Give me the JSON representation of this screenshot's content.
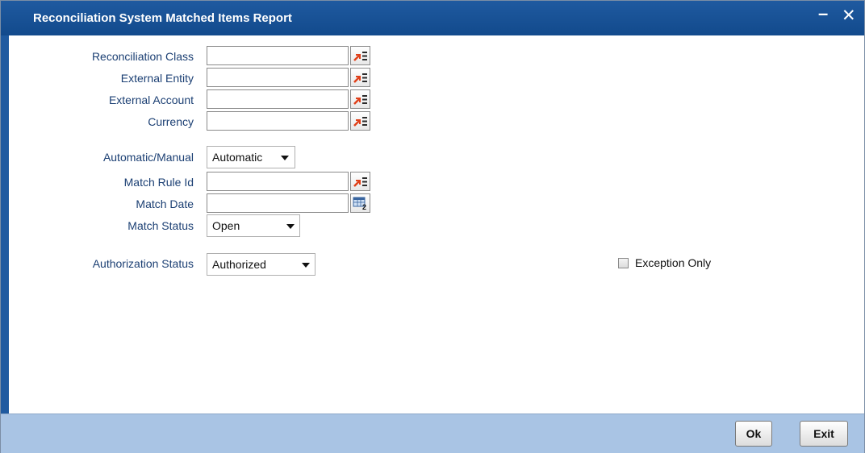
{
  "window": {
    "title": "Reconciliation System Matched Items Report",
    "minimize_glyph": "–",
    "close_glyph": "✕"
  },
  "form": {
    "reconciliation_class": {
      "label": "Reconciliation Class",
      "value": "",
      "icon": "lov-icon"
    },
    "external_entity": {
      "label": "External Entity",
      "value": "",
      "icon": "lov-icon"
    },
    "external_account": {
      "label": "External Account",
      "value": "",
      "icon": "lov-icon"
    },
    "currency": {
      "label": "Currency",
      "value": "",
      "icon": "lov-icon"
    },
    "automatic_manual": {
      "label": "Automatic/Manual",
      "selected": "Automatic"
    },
    "match_rule_id": {
      "label": "Match Rule Id",
      "value": "",
      "icon": "lov-icon"
    },
    "match_date": {
      "label": "Match Date",
      "value": "",
      "icon": "calendar-icon"
    },
    "match_status": {
      "label": "Match Status",
      "selected": "Open"
    },
    "authorization_status": {
      "label": "Authorization Status",
      "selected": "Authorized"
    },
    "exception_only": {
      "label": "Exception Only",
      "checked": false
    }
  },
  "footer": {
    "ok_label": "Ok",
    "exit_label": "Exit"
  },
  "colors": {
    "title_bar": "#1f5aa0",
    "footer_bar": "#a9c4e4",
    "label_text": "#1b3f73"
  }
}
